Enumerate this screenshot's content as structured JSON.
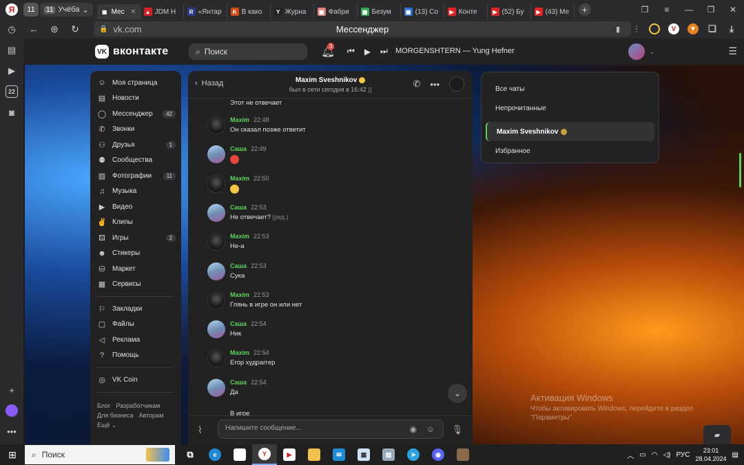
{
  "browser": {
    "tab_counter": "11",
    "group": {
      "count": "11",
      "label": "Учёба"
    },
    "tabs": [
      {
        "label": "Мес",
        "color": "#333333",
        "glyph": "▣",
        "active": true
      },
      {
        "label": "JDM Н",
        "color": "#d22222",
        "glyph": "▲",
        "active": false
      },
      {
        "label": "«Янтар",
        "color": "#2b3a8c",
        "glyph": "R",
        "active": false
      },
      {
        "label": "В како",
        "color": "#d24a12",
        "glyph": "K",
        "active": false
      },
      {
        "label": "Журна",
        "color": "#222222",
        "glyph": "Y",
        "active": false
      },
      {
        "label": "Фабри",
        "color": "#e08080",
        "glyph": "▦",
        "active": false
      },
      {
        "label": "Безум",
        "color": "#3aa655",
        "glyph": "▦",
        "active": false
      },
      {
        "label": "(13) Со",
        "color": "#2d6fd6",
        "glyph": "▦",
        "active": false
      },
      {
        "label": "Конте",
        "color": "#e02424",
        "glyph": "▶",
        "active": false
      },
      {
        "label": "(52) Бу",
        "color": "#e02424",
        "glyph": "▶",
        "active": false
      },
      {
        "label": "(43) Ме",
        "color": "#e02424",
        "glyph": "▶",
        "active": false
      }
    ],
    "url": "vk.com",
    "page_title": "Мессенджер"
  },
  "vk": {
    "brand": "вконтакте",
    "search_placeholder": "Поиск",
    "notifications_badge": "3",
    "now_playing": "MORGENSHTERN — Yung Hefner"
  },
  "menu": {
    "items": [
      {
        "label": "Моя страница",
        "icon": "user-circle-icon",
        "glyph": "☺",
        "count": ""
      },
      {
        "label": "Новости",
        "icon": "news-icon",
        "glyph": "▤",
        "count": ""
      },
      {
        "label": "Мессенджер",
        "icon": "chat-icon",
        "glyph": "◯",
        "count": "42"
      },
      {
        "label": "Звонки",
        "icon": "phone-icon",
        "glyph": "✆",
        "count": ""
      },
      {
        "label": "Друзья",
        "icon": "friends-icon",
        "glyph": "⚇",
        "count": "1"
      },
      {
        "label": "Сообщества",
        "icon": "communities-icon",
        "glyph": "⚉",
        "count": ""
      },
      {
        "label": "Фотографии",
        "icon": "photo-icon",
        "glyph": "▨",
        "count": "11"
      },
      {
        "label": "Музыка",
        "icon": "music-icon",
        "glyph": "♫",
        "count": ""
      },
      {
        "label": "Видео",
        "icon": "video-icon",
        "glyph": "▶",
        "count": ""
      },
      {
        "label": "Клипы",
        "icon": "clips-icon",
        "glyph": "✌",
        "count": ""
      },
      {
        "label": "Игры",
        "icon": "games-icon",
        "glyph": "⚄",
        "count": "2"
      },
      {
        "label": "Стикеры",
        "icon": "stickers-icon",
        "glyph": "☻",
        "count": ""
      },
      {
        "label": "Маркет",
        "icon": "market-icon",
        "glyph": "⛁",
        "count": ""
      },
      {
        "label": "Сервисы",
        "icon": "services-icon",
        "glyph": "▦",
        "count": ""
      }
    ],
    "items2": [
      {
        "label": "Закладки",
        "icon": "bookmark-icon",
        "glyph": "⚐"
      },
      {
        "label": "Файлы",
        "icon": "file-icon",
        "glyph": "▢"
      },
      {
        "label": "Реклама",
        "icon": "megaphone-icon",
        "glyph": "◁"
      },
      {
        "label": "Помощь",
        "icon": "help-icon",
        "glyph": "?"
      }
    ],
    "items3": [
      {
        "label": "VK Coin",
        "icon": "coin-icon",
        "glyph": "◎"
      }
    ],
    "footer": [
      "Блог",
      "Разработчикам",
      "Для бизнеса",
      "Авторам",
      "Ещё ⌄"
    ]
  },
  "chat": {
    "back_label": "Назад",
    "title": "Maxim Sveshnikov",
    "status": "был в сети сегодня в 16:42",
    "top_text": "Этот не отвечает",
    "messages": [
      {
        "author": "Maxim",
        "time": "22:48",
        "text": "Он сказал позже ответит",
        "who": "maxim",
        "emoji": "",
        "edited": ""
      },
      {
        "author": "Саша",
        "time": "22:49",
        "text": "",
        "who": "sasha",
        "emoji": "angry",
        "edited": ""
      },
      {
        "author": "Maxim",
        "time": "22:50",
        "text": "",
        "who": "maxim",
        "emoji": "laugh",
        "edited": ""
      },
      {
        "author": "Саша",
        "time": "22:53",
        "text": "Не отвечает?",
        "who": "sasha",
        "emoji": "",
        "edited": "(ред.)"
      },
      {
        "author": "Maxim",
        "time": "22:53",
        "text": "Не-а",
        "who": "maxim",
        "emoji": "",
        "edited": ""
      },
      {
        "author": "Саша",
        "time": "22:53",
        "text": "Сука",
        "who": "sasha",
        "emoji": "",
        "edited": ""
      },
      {
        "author": "Maxim",
        "time": "22:53",
        "text": "Глянь в игре он или нет",
        "who": "maxim",
        "emoji": "",
        "edited": ""
      },
      {
        "author": "Саша",
        "time": "22:54",
        "text": "Ник",
        "who": "sasha",
        "emoji": "",
        "edited": ""
      },
      {
        "author": "Maxim",
        "time": "22:54",
        "text": "Егор худраггер",
        "who": "maxim",
        "emoji": "",
        "edited": ""
      },
      {
        "author": "Саша",
        "time": "22:54",
        "text": "Да",
        "who": "sasha",
        "emoji": "",
        "edited": ""
      }
    ],
    "tail_text": "В игре",
    "composer_placeholder": "Напишите сообщение..."
  },
  "filters": {
    "items": [
      "Все чаты",
      "Непрочитанные"
    ],
    "selected": "Maxim Sveshnikov",
    "favorites": "Избранное"
  },
  "windows": {
    "activate_title": "Активация Windows",
    "activate_text": "Чтобы активировать Windows, перейдите в раздел \"Параметры\".",
    "taskbar_search": "Поиск",
    "lang": "РУС",
    "time": "23:01",
    "date": "28.04.2024"
  },
  "colors": {
    "author_green": "#5bd35b",
    "badge_red": "#e64646"
  }
}
